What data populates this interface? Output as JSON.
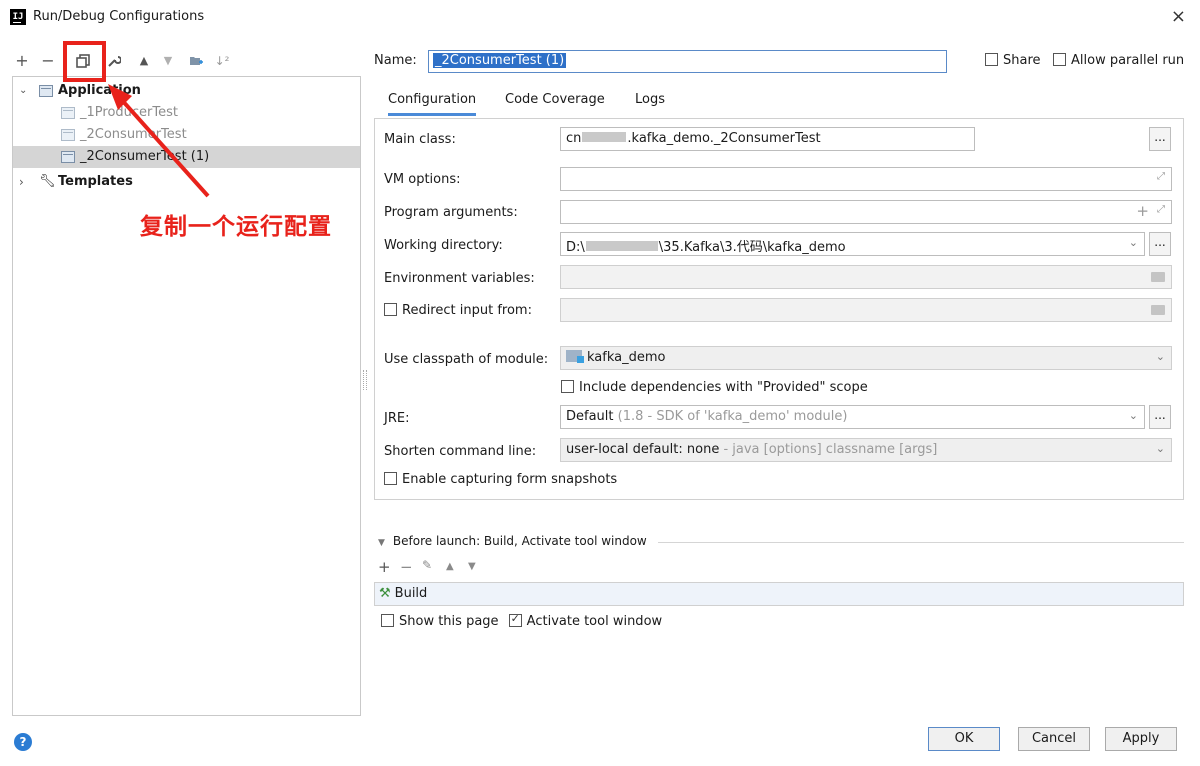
{
  "window": {
    "title": "Run/Debug Configurations",
    "close_label": "×",
    "app_icon": "IJ"
  },
  "toolbar": {
    "add": "+",
    "remove": "−",
    "copy_icon": "copy-icon",
    "edit_defaults_icon": "wrench-icon",
    "move_up": "▲",
    "move_down": "▼",
    "folder_icon": "new-folder-icon",
    "sort_icon": "sort-icon"
  },
  "tree": {
    "application": "Application",
    "items": [
      "_1ProducerTest",
      "_2ConsumerTest",
      "_2ConsumerTest (1)"
    ],
    "templates": "Templates"
  },
  "annotation": {
    "text": "复制一个运行配置",
    "color": "#e8221b"
  },
  "header": {
    "name_label": "Name:",
    "name_value": "_2ConsumerTest (1)",
    "share_label": "Share",
    "parallel_label": "Allow parallel run"
  },
  "tabs": [
    "Configuration",
    "Code Coverage",
    "Logs"
  ],
  "form": {
    "main_class_label": "Main class:",
    "main_class_prefix": "cn",
    "main_class_suffix": ".kafka_demo._2ConsumerTest",
    "vm_options_label": "VM options:",
    "program_args_label": "Program arguments:",
    "working_dir_label": "Working directory:",
    "working_dir_prefix": "D:\\",
    "working_dir_suffix": "\\35.Kafka\\3.代码\\kafka_demo",
    "env_vars_label": "Environment variables:",
    "redirect_label": "Redirect input from:",
    "classpath_label": "Use classpath of module:",
    "classpath_value": "kafka_demo",
    "include_deps_label": "Include dependencies with \"Provided\" scope",
    "jre_label": "JRE:",
    "jre_value": "Default",
    "jre_hint": " (1.8 - SDK of 'kafka_demo' module)",
    "shorten_label": "Shorten command line:",
    "shorten_value": "user-local default: none",
    "shorten_hint": " - java [options] classname [args]",
    "snapshots_label": "Enable capturing form snapshots",
    "dots": "..."
  },
  "before_launch": {
    "header": "Before launch: Build, Activate tool window",
    "build_item": "Build",
    "show_page_label": "Show this page",
    "activate_label": "Activate tool window"
  },
  "buttons": {
    "ok": "OK",
    "cancel": "Cancel",
    "apply": "Apply",
    "help": "?"
  },
  "colors": {
    "accent": "#4a8ad8",
    "selection": "#2e70c8",
    "annotation_red": "#e8221b"
  }
}
